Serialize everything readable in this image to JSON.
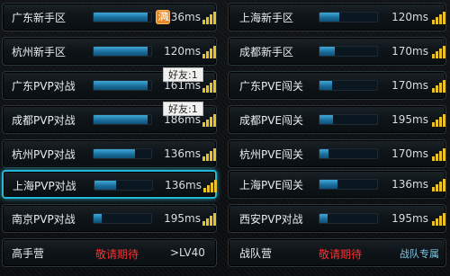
{
  "servers_left": [
    {
      "name": "广东新手区",
      "ping": "136ms",
      "fill": 0.94,
      "badge": "满"
    },
    {
      "name": "杭州新手区",
      "ping": "120ms",
      "fill": 0.94
    },
    {
      "name": "广东PVP对战",
      "ping": "161ms",
      "fill": 0.94,
      "tooltip": "好友:1"
    },
    {
      "name": "成都PVP对战",
      "ping": "186ms",
      "fill": 0.94,
      "tooltip": "好友:1"
    },
    {
      "name": "杭州PVP对战",
      "ping": "136ms",
      "fill": 0.72
    },
    {
      "name": "上海PVP对战",
      "ping": "136ms",
      "fill": 0.38
    },
    {
      "name": "南京PVP对战",
      "ping": "195ms",
      "fill": 0.14
    }
  ],
  "servers_right": [
    {
      "name": "上海新手区",
      "ping": "120ms",
      "fill": 0.34
    },
    {
      "name": "成都新手区",
      "ping": "170ms",
      "fill": 0.26
    },
    {
      "name": "广东PVE闯关",
      "ping": "170ms",
      "fill": 0.22
    },
    {
      "name": "成都PVE闯关",
      "ping": "195ms",
      "fill": 0.24
    },
    {
      "name": "杭州PVE闯关",
      "ping": "170ms",
      "fill": 0.16
    },
    {
      "name": "上海PVE闯关",
      "ping": "136ms",
      "fill": 0.32
    },
    {
      "name": "西安PVP对战",
      "ping": "195ms",
      "fill": 0.14
    }
  ],
  "bottom_left": {
    "name": "高手营",
    "status": "敬请期待",
    "requirement": ">LV40"
  },
  "bottom_right": {
    "name": "战队营",
    "status": "敬请期待",
    "note": "战队专属"
  },
  "colors": {
    "accent": "#23b8d6",
    "bar": "#2f8fc0",
    "signal": "#e8c12b",
    "coming_soon": "#ff2f2f",
    "badge": "#e28a2b"
  },
  "icons": {
    "signal": "signal-strength-icon",
    "full": "server-full-badge-icon"
  }
}
